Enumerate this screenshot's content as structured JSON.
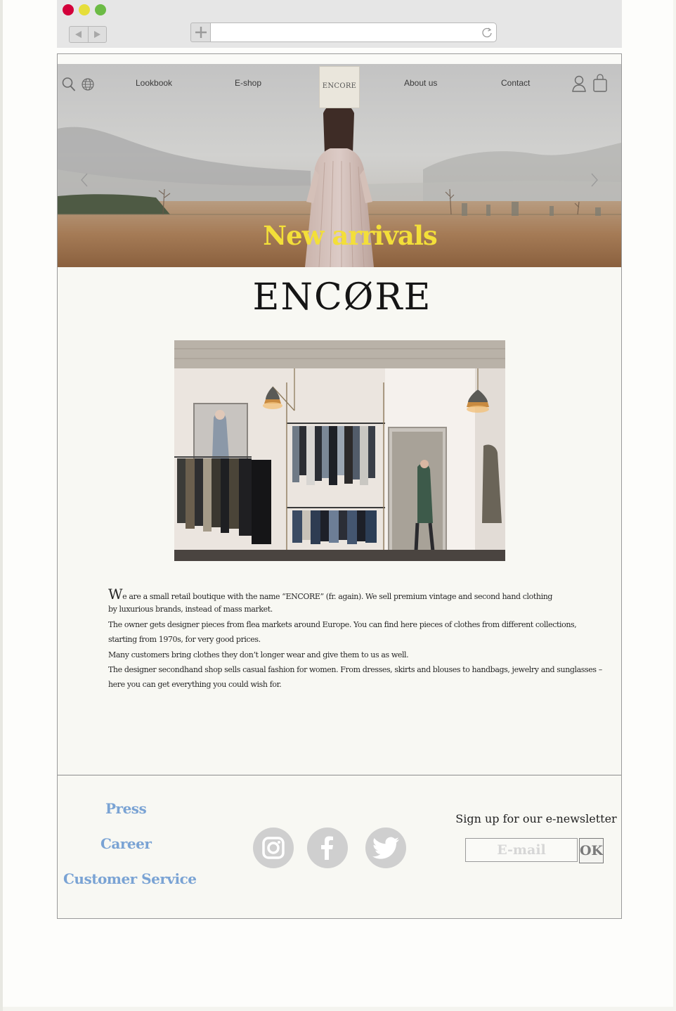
{
  "browser": {
    "back_icon": "triangle-left-icon",
    "forward_icon": "triangle-right-icon",
    "new_tab_icon": "plus-icon",
    "url": "",
    "reload_icon": "reload-icon",
    "traffic_lights": [
      "#d3003a",
      "#e6de3a",
      "#6cbb45"
    ]
  },
  "nav": {
    "items": [
      "Lookbook",
      "E-shop",
      "About us",
      "Contact"
    ],
    "logo": "ENCORE",
    "left_icons": [
      "search-icon",
      "globe-icon"
    ],
    "right_icons": [
      "user-icon",
      "shopping-bag-icon"
    ]
  },
  "hero": {
    "title": "New arrivals",
    "title_color": "#f3df39"
  },
  "brand": "ENCØRE",
  "description": {
    "initial": "W",
    "lines": [
      "e are a small retail boutique with the name “ENCORE” (fr. again).  We sell premium vintage and second hand clothing",
      " by luxurious brands, instead of mass market.",
      "The owner gets designer pieces from flea markets around Europe. You can find here pieces of clothes from different collections,",
      "starting from 1970s, for very good prices.",
      "Many customers bring clothes they don’t longer wear and give them to us as well.",
      "The designer secondhand shop sells casual fashion for women. From dresses, skirts and blouses to handbags, jewelry and sunglasses –",
      " here you can get everything you could wish for."
    ]
  },
  "footer": {
    "links": [
      "Press",
      "Career",
      "Customer Service"
    ],
    "link_color": "#7aa3d4",
    "social": [
      "instagram-icon",
      "facebook-icon",
      "twitter-icon"
    ],
    "newsletter": {
      "title": "Sign up for our e-newsletter",
      "placeholder": "E-mail",
      "button": "OK"
    }
  }
}
